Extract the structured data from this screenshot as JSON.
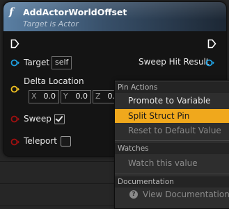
{
  "node": {
    "icon_glyph": "f",
    "title": "AddActorWorldOffset",
    "subtitle": "Target is Actor",
    "pins": {
      "target_label": "Target",
      "target_default": "self",
      "sweep_hit_result_label": "Sweep Hit Result",
      "delta_location_label": "Delta Location",
      "delta_location": {
        "x_axis": "X",
        "x_value": "0.0",
        "y_axis": "Y",
        "y_value": "0.0",
        "z_axis": "Z",
        "z_value": "0.0"
      },
      "sweep_label": "Sweep",
      "sweep_checked": true,
      "teleport_label": "Teleport",
      "teleport_checked": false
    }
  },
  "context_menu": {
    "sections": [
      {
        "header": "Pin Actions",
        "items": [
          {
            "label": "Promote to Variable",
            "enabled": true,
            "highlighted": false
          },
          {
            "label": "Split Struct Pin",
            "enabled": true,
            "highlighted": true
          },
          {
            "label": "Reset to Default Value",
            "enabled": false,
            "highlighted": false
          }
        ]
      },
      {
        "header": "Watches",
        "items": [
          {
            "label": "Watch this value",
            "enabled": false,
            "highlighted": false
          }
        ]
      },
      {
        "header": "Documentation",
        "items": [
          {
            "label": "View Documentation",
            "enabled": false,
            "highlighted": false,
            "icon": "help-icon"
          }
        ]
      }
    ]
  },
  "colors": {
    "header_blue": "#5a7fa3",
    "object_pin": "#1f9fe0",
    "vector_pin": "#f0c020",
    "bool_pin": "#a01010",
    "highlight": "#f0a81c"
  }
}
